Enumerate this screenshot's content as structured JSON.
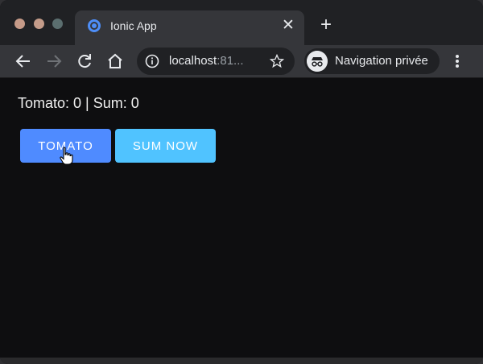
{
  "browser": {
    "tab": {
      "title": "Ionic App",
      "close_glyph": "✕"
    },
    "new_tab_glyph": "+",
    "address_bar": {
      "host": "localhost",
      "port_truncated": ":81..."
    },
    "profile": {
      "label": "Navigation privée"
    },
    "colors": {
      "tabstrip": "#202124",
      "toolbar": "#35363a",
      "favicon": "#4e8ef7"
    }
  },
  "page": {
    "status_text": "Tomato: 0 | Sum: 0",
    "buttons": {
      "tomato": "TOMATO",
      "sum_now": "SUM NOW"
    },
    "colors": {
      "tomato_button": "#4f8bff",
      "sum_button": "#50c3ff",
      "background": "#0e0e10"
    }
  }
}
